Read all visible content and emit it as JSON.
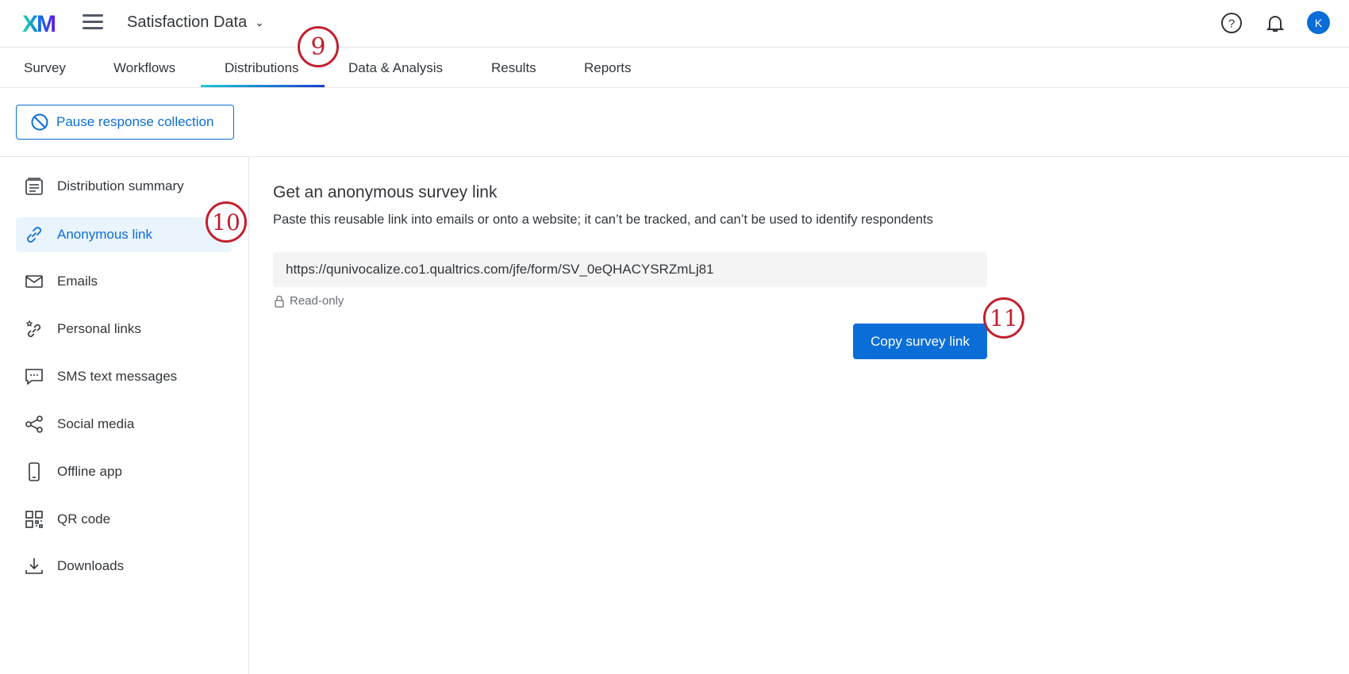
{
  "header": {
    "logo": "XM",
    "project": "Satisfaction Data",
    "avatar": "K"
  },
  "tabs": [
    "Survey",
    "Workflows",
    "Distributions",
    "Data & Analysis",
    "Results",
    "Reports"
  ],
  "pause_label": "Pause response collection",
  "sidebar": [
    "Distribution summary",
    "Anonymous link",
    "Emails",
    "Personal links",
    "SMS text messages",
    "Social media",
    "Offline app",
    "QR code",
    "Downloads"
  ],
  "main": {
    "title": "Get an anonymous survey link",
    "description": "Paste this reusable link into emails or onto a website; it can’t be tracked, and can’t be used to identify respondents",
    "url": "https://qunivocalize.co1.qualtrics.com/jfe/form/SV_0eQHACYSRZmLj81",
    "readonly": "Read-only",
    "copy_label": "Copy survey link"
  },
  "annotations": [
    "9",
    "10",
    "11"
  ],
  "colors": {
    "accent": "#0b6ed8",
    "annotation": "#c0202f"
  }
}
